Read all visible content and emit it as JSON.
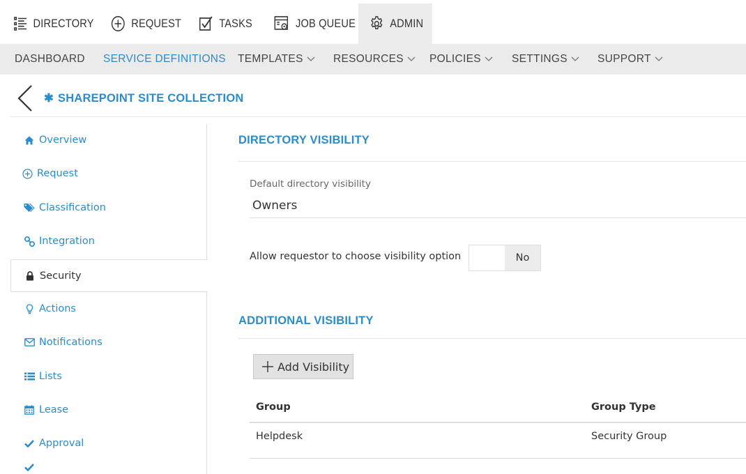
{
  "topnav": {
    "items": [
      {
        "label": "DIRECTORY",
        "icon": "list-icon"
      },
      {
        "label": "REQUEST",
        "icon": "plus-circle-icon"
      },
      {
        "label": "TASKS",
        "icon": "checkbox-icon"
      },
      {
        "label": "JOB QUEUE",
        "icon": "job-queue-icon"
      },
      {
        "label": "ADMIN",
        "icon": "gear-icon",
        "active": true
      }
    ]
  },
  "subnav": {
    "items": [
      {
        "label": "DASHBOARD"
      },
      {
        "label": "SERVICE DEFINITIONS",
        "active": true
      },
      {
        "label": "TEMPLATES",
        "dropdown": true
      },
      {
        "label": "RESOURCES",
        "dropdown": true
      },
      {
        "label": "POLICIES",
        "dropdown": true
      },
      {
        "label": "SETTINGS",
        "dropdown": true
      },
      {
        "label": "SUPPORT",
        "dropdown": true
      }
    ]
  },
  "page": {
    "title": "SHAREPOINT SITE COLLECTION"
  },
  "sidemenu": {
    "items": [
      {
        "label": "Overview",
        "icon": "home-icon"
      },
      {
        "label": "Request",
        "icon": "plus-circle-icon"
      },
      {
        "label": "Classification",
        "icon": "tags-icon"
      },
      {
        "label": "Integration",
        "icon": "link-icon"
      },
      {
        "label": "Security",
        "icon": "lock-icon",
        "active": true
      },
      {
        "label": "Actions",
        "icon": "lightbulb-icon"
      },
      {
        "label": "Notifications",
        "icon": "envelope-icon"
      },
      {
        "label": "Lists",
        "icon": "list-icon"
      },
      {
        "label": "Lease",
        "icon": "calendar-icon"
      },
      {
        "label": "Approval",
        "icon": "check-icon"
      }
    ]
  },
  "directory_visibility": {
    "title": "DIRECTORY VISIBILITY",
    "default_label": "Default directory visibility",
    "default_value": "Owners",
    "allow_label": "Allow requestor to choose visibility option",
    "allow_value": "No"
  },
  "additional_visibility": {
    "title": "ADDITIONAL VISIBILITY",
    "add_button": "Add Visibility",
    "columns": [
      "Group",
      "Group Type"
    ],
    "rows": [
      {
        "group": "Helpdesk",
        "group_type": "Security Group"
      }
    ]
  },
  "colors": {
    "accent": "#2a8dc9",
    "subnav_bg": "#ebebeb",
    "admin_tab_bg": "#ececec"
  }
}
